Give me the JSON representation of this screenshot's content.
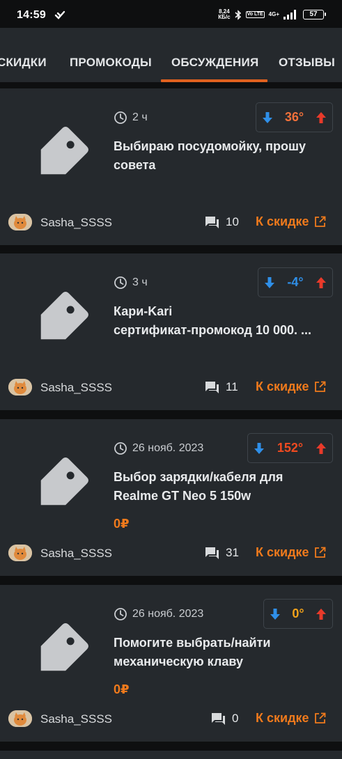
{
  "status_bar": {
    "time": "14:59",
    "speed_value": "8,24",
    "speed_unit": "КБ/с",
    "volte": "Vo LTE",
    "network": "4G+",
    "battery": "57"
  },
  "tabs": [
    {
      "label": "СКИДКИ",
      "active": false
    },
    {
      "label": "ПРОМОКОДЫ",
      "active": false
    },
    {
      "label": "ОБСУЖДЕНИЯ",
      "active": true
    },
    {
      "label": "ОТЗЫВЫ",
      "active": false
    }
  ],
  "accent_color": "#e0611f",
  "cards": [
    {
      "time": "2 ч",
      "temperature": "36°",
      "temperature_color": "#f0703a",
      "title": "Выбираю посудомойку, прошу совета",
      "price": "",
      "author": "Sasha_SSSS",
      "comments": "10",
      "link_label": "К скидке"
    },
    {
      "time": "3 ч",
      "temperature": "-4°",
      "temperature_color": "#2f8fe8",
      "title_line1": "Кари-Kari",
      "title_line2": "сертификат-промокод 10 000. ...",
      "price": "",
      "author": "Sasha_SSSS",
      "comments": "11",
      "link_label": "К скидке"
    },
    {
      "time": "26 нояб. 2023",
      "temperature": "152°",
      "temperature_color": "#f04a20",
      "title": "Выбор зарядки/кабеля для Realme GT Neo 5 150w",
      "price": "0₽",
      "author": "Sasha_SSSS",
      "comments": "31",
      "link_label": "К скидке"
    },
    {
      "time": "26 нояб. 2023",
      "temperature": "0°",
      "temperature_color": "#f2a21a",
      "title": "Помогите выбрать/найти механическую клаву",
      "price": "0₽",
      "author": "Sasha_SSSS",
      "comments": "0",
      "link_label": "К скидке"
    }
  ]
}
